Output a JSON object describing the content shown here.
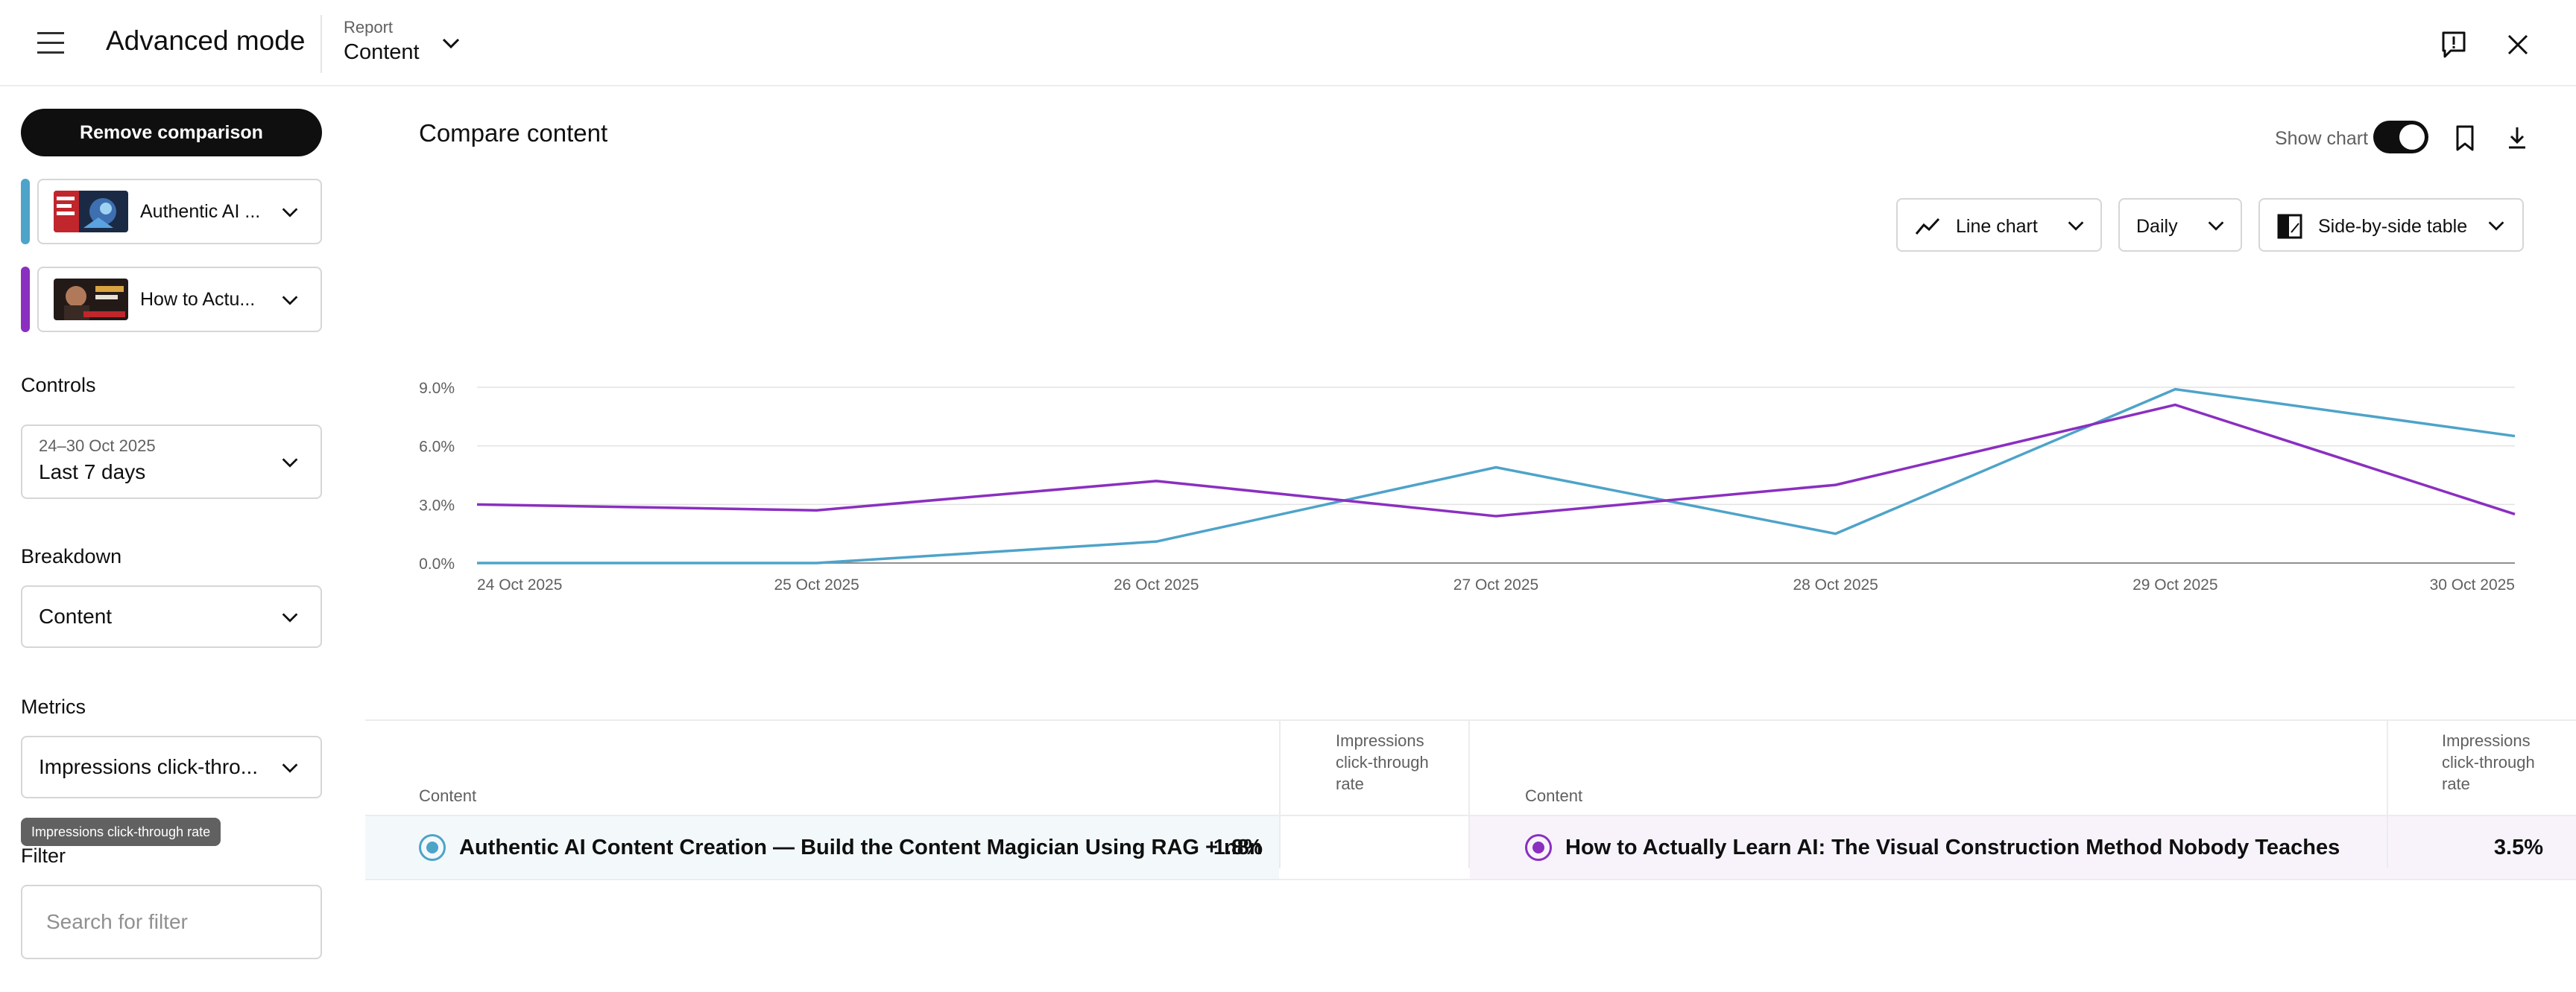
{
  "header": {
    "title": "Advanced mode",
    "report_caption": "Report",
    "report_value": "Content"
  },
  "sidebar": {
    "remove_comparison": "Remove comparison",
    "comparisons": [
      {
        "label": "Authentic AI ...",
        "color": "#4ea3c9"
      },
      {
        "label": "How to Actu...",
        "color": "#8a2fc0"
      }
    ],
    "controls": {
      "title": "Controls",
      "date_range": "24–30 Oct 2025",
      "period": "Last 7 days"
    },
    "breakdown": {
      "title": "Breakdown",
      "value": "Content"
    },
    "metrics": {
      "title": "Metrics",
      "value": "Impressions click-thro...",
      "tooltip": "Impressions click-through rate"
    },
    "filter": {
      "title": "Filter",
      "placeholder": "Search for filter"
    }
  },
  "main": {
    "title": "Compare content",
    "show_chart_label": "Show chart",
    "show_chart_on": true,
    "chart_type_label": "Line chart",
    "granularity_label": "Daily",
    "table_mode_label": "Side-by-side table"
  },
  "chart_data": {
    "type": "line",
    "x": [
      "24 Oct 2025",
      "25 Oct 2025",
      "26 Oct 2025",
      "27 Oct 2025",
      "28 Oct 2025",
      "29 Oct 2025",
      "30 Oct 2025"
    ],
    "y_ticks": [
      "0.0%",
      "3.0%",
      "6.0%",
      "9.0%"
    ],
    "ylim": [
      0,
      9
    ],
    "grid": true,
    "series": [
      {
        "name": "Authentic AI Content Creation — Build the Content Magician Using RAG + n8n",
        "color": "#4ea3c9",
        "values": [
          0.0,
          0.0,
          1.1,
          4.9,
          1.5,
          8.9,
          6.5
        ]
      },
      {
        "name": "How to Actually Learn AI: The Visual Construction Method Nobody Teaches",
        "color": "#8a2fc0",
        "values": [
          3.0,
          2.7,
          4.2,
          2.4,
          4.0,
          8.1,
          2.5
        ]
      }
    ]
  },
  "table": {
    "left": {
      "col_content": "Content",
      "col_metric": "Impressions click-through rate",
      "title": "Authentic AI Content Creation — Build the Content Magician Using RAG + n8n",
      "value": "1.8%",
      "color": "#4ea3c9",
      "row_bg": "#f3f9fa"
    },
    "right": {
      "col_content": "Content",
      "col_metric": "Impressions click-through rate",
      "title": "How to Actually Learn AI: The Visual Construction Method Nobody Teaches",
      "value": "3.5%",
      "color": "#8a2fc0",
      "row_bg": "#f8f3fb"
    }
  }
}
